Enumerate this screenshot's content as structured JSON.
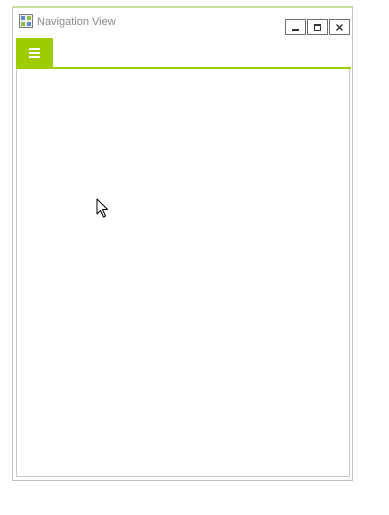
{
  "window": {
    "title": "Navigation View",
    "controls": {
      "minimize": "minimize-icon",
      "maximize": "maximize-icon",
      "close": "close-icon"
    }
  },
  "navigation": {
    "menu_icon": "hamburger-icon"
  },
  "colors": {
    "accent": "#9ecc00",
    "window_border": "#c0c0c0",
    "title_text": "#888888",
    "panel_border": "#c8c8c8"
  }
}
